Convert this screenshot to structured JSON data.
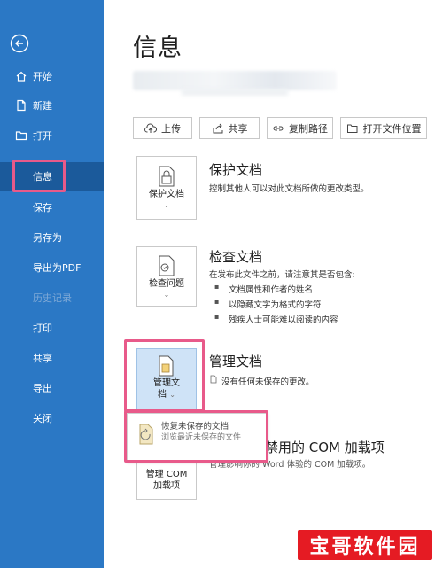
{
  "sidebar": {
    "items": [
      {
        "label": "开始",
        "icon": "home-icon"
      },
      {
        "label": "新建",
        "icon": "new-document-icon"
      },
      {
        "label": "打开",
        "icon": "folder-icon"
      },
      {
        "label": "信息",
        "icon": ""
      },
      {
        "label": "保存",
        "icon": ""
      },
      {
        "label": "另存为",
        "icon": ""
      },
      {
        "label": "导出为PDF",
        "icon": ""
      },
      {
        "label": "历史记录",
        "icon": ""
      },
      {
        "label": "打印",
        "icon": ""
      },
      {
        "label": "共享",
        "icon": ""
      },
      {
        "label": "导出",
        "icon": ""
      },
      {
        "label": "关闭",
        "icon": ""
      }
    ],
    "selected": "信息",
    "accent": "#2b78c5"
  },
  "main": {
    "title": "信息",
    "toolbar": [
      {
        "label": "上传",
        "icon": "upload-cloud-icon"
      },
      {
        "label": "共享",
        "icon": "share-icon"
      },
      {
        "label": "复制路径",
        "icon": "link-icon"
      },
      {
        "label": "打开文件位置",
        "icon": "folder-open-icon"
      }
    ],
    "sections": {
      "protect": {
        "button": "保护文档",
        "title": "保护文档",
        "desc": "控制其他人可以对此文档所做的更改类型。"
      },
      "inspect": {
        "button": "检查问题",
        "title": "检查文档",
        "desc": "在发布此文件之前，请注意其是否包含:",
        "bullets": [
          "文档属性和作者的姓名",
          "以隐藏文字为格式的字符",
          "残疾人士可能难以阅读的内容"
        ]
      },
      "manage": {
        "button_line1": "管理文",
        "button_line2": "档",
        "title": "管理文档",
        "desc": "没有任何未保存的更改。",
        "popup": {
          "title": "恢复未保存的文档",
          "desc": "浏览最近未保存的文件"
        }
      },
      "com": {
        "button_line1": "管理 COM",
        "button_line2": "加载项",
        "title": "已禁用的 COM 加载项",
        "desc": "管理影响你的 Word 体验的 COM 加载项。"
      }
    }
  },
  "watermark": "宝哥软件园",
  "highlight_color": "#e85a8a"
}
